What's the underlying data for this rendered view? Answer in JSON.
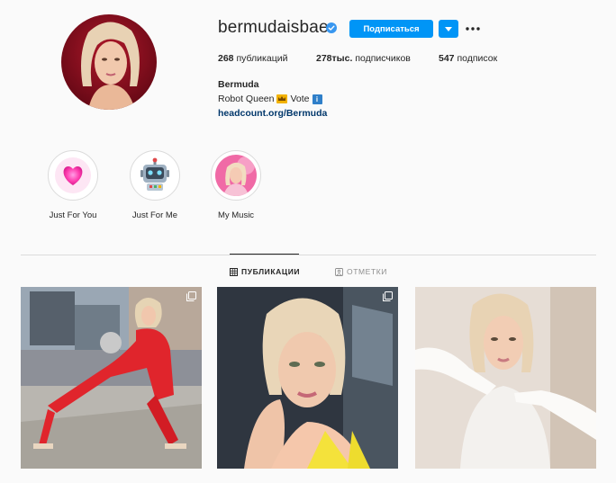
{
  "profile": {
    "username": "bermudaisbae",
    "follow_label": "Подписаться",
    "posts_count": "268",
    "posts_label": "публикаций",
    "followers_count": "278тыс.",
    "followers_label": "подписчиков",
    "following_count": "547",
    "following_label": "подписок",
    "name": "Bermuda",
    "bio_text_1": "Robot Queen",
    "bio_text_2": "Vote",
    "link": "headcount.org/Bermuda"
  },
  "highlights": [
    {
      "label": "Just For You",
      "icon": "heart-icon"
    },
    {
      "label": "Just For Me",
      "icon": "robot-icon"
    },
    {
      "label": "My Music",
      "icon": "portrait-icon"
    }
  ],
  "tabs": [
    {
      "label": "ПУБЛИКАЦИИ",
      "icon": "grid-icon",
      "active": true
    },
    {
      "label": "ОТМЕТКИ",
      "icon": "tag-icon",
      "active": false
    }
  ],
  "colors": {
    "accent": "#0095f6",
    "link": "#00376b",
    "verified": "#3897f0"
  }
}
